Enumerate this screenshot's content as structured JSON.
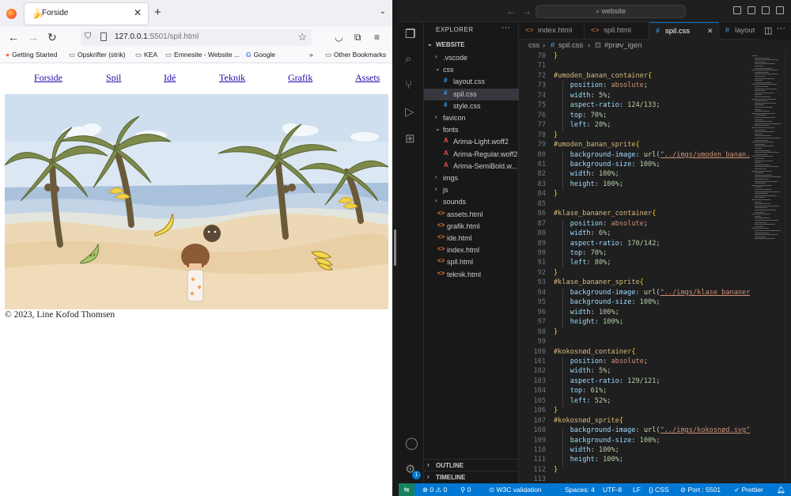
{
  "browser": {
    "tab_title": "Forside",
    "url_host": "127.0.0.1",
    "url_rest": ":5501/spil.html",
    "bookmarks": [
      "Getting Started",
      "Opskrifter (strik)",
      "KEA",
      "Emnesite - Website ...",
      "Google",
      "Other Bookmarks"
    ],
    "site_nav": [
      "Forside",
      "Spil",
      "Idé",
      "Teknik",
      "Grafik",
      "Assets"
    ],
    "footer": "© 2023, Line Kofod Thomsen"
  },
  "vscode": {
    "search_text": "website",
    "explorer_title": "EXPLORER",
    "workspace": "WEBSITE",
    "tree": [
      {
        "name": ".vscode",
        "type": "folder",
        "open": false,
        "depth": 0
      },
      {
        "name": "css",
        "type": "folder",
        "open": true,
        "depth": 0
      },
      {
        "name": "layout.css",
        "type": "css",
        "depth": 1
      },
      {
        "name": "spil.css",
        "type": "css",
        "depth": 1,
        "selected": true
      },
      {
        "name": "style.css",
        "type": "css",
        "depth": 1
      },
      {
        "name": "favicon",
        "type": "folder",
        "open": false,
        "depth": 0
      },
      {
        "name": "fonts",
        "type": "folder",
        "open": true,
        "depth": 0
      },
      {
        "name": "Arima-Light.woff2",
        "type": "font",
        "depth": 1
      },
      {
        "name": "Arima-Regular.woff2",
        "type": "font",
        "depth": 1
      },
      {
        "name": "Arima-SemiBold.w...",
        "type": "font",
        "depth": 1
      },
      {
        "name": "imgs",
        "type": "folder",
        "open": false,
        "depth": 0
      },
      {
        "name": "js",
        "type": "folder",
        "open": false,
        "depth": 0
      },
      {
        "name": "sounds",
        "type": "folder",
        "open": false,
        "depth": 0
      },
      {
        "name": "assets.html",
        "type": "html",
        "depth": 0
      },
      {
        "name": "grafik.html",
        "type": "html",
        "depth": 0
      },
      {
        "name": "ide.html",
        "type": "html",
        "depth": 0
      },
      {
        "name": "index.html",
        "type": "html",
        "depth": 0
      },
      {
        "name": "spil.html",
        "type": "html",
        "depth": 0
      },
      {
        "name": "teknik.html",
        "type": "html",
        "depth": 0
      }
    ],
    "outline_label": "OUTLINE",
    "timeline_label": "TIMELINE",
    "tabs": [
      {
        "label": "index.html",
        "icon": "html",
        "active": false
      },
      {
        "label": "spil.html",
        "icon": "html",
        "active": false
      },
      {
        "label": "spil.css",
        "icon": "css",
        "active": true
      },
      {
        "label": "layout",
        "icon": "css",
        "active": false
      }
    ],
    "breadcrumb": [
      "css",
      "spil.css",
      "#prøv_igen"
    ],
    "code_lines": [
      {
        "n": "70",
        "t": "}"
      },
      {
        "n": "71",
        "t": ""
      },
      {
        "n": "72",
        "t": "#umoden_banan_container{"
      },
      {
        "n": "73",
        "t": "    position: absolute;"
      },
      {
        "n": "74",
        "t": "    width: 5%;"
      },
      {
        "n": "75",
        "t": "    aspect-ratio: 124/133;"
      },
      {
        "n": "76",
        "t": "    top: 70%;"
      },
      {
        "n": "77",
        "t": "    left: 20%;"
      },
      {
        "n": "78",
        "t": "}"
      },
      {
        "n": "79",
        "t": "#umoden_banan_sprite{"
      },
      {
        "n": "80",
        "t": "    background-image: url(\"../imgs/umoden_banan.svg\");"
      },
      {
        "n": "81",
        "t": "    background-size: 100%;"
      },
      {
        "n": "82",
        "t": "    width: 100%;"
      },
      {
        "n": "83",
        "t": "    height: 100%;"
      },
      {
        "n": "84",
        "t": "}"
      },
      {
        "n": "85",
        "t": ""
      },
      {
        "n": "86",
        "t": "#klase_bananer_container{"
      },
      {
        "n": "87",
        "t": "    position: absolute;"
      },
      {
        "n": "88",
        "t": "    width: 6%;"
      },
      {
        "n": "89",
        "t": "    aspect-ratio: 170/142;"
      },
      {
        "n": "90",
        "t": "    top: 70%;"
      },
      {
        "n": "91",
        "t": "    left: 80%;"
      },
      {
        "n": "92",
        "t": "}"
      },
      {
        "n": "93",
        "t": "#klase_bananer_sprite{"
      },
      {
        "n": "94",
        "t": "    background-image: url(\"../imgs/klase_bananer.svg\");"
      },
      {
        "n": "95",
        "t": "    background-size: 100%;"
      },
      {
        "n": "96",
        "t": "    width: 100%;"
      },
      {
        "n": "97",
        "t": "    height: 100%;"
      },
      {
        "n": "98",
        "t": "}"
      },
      {
        "n": "99",
        "t": ""
      },
      {
        "n": "100",
        "t": "#kokosnød_container{"
      },
      {
        "n": "101",
        "t": "    position: absolute;"
      },
      {
        "n": "102",
        "t": "    width: 5%;"
      },
      {
        "n": "103",
        "t": "    aspect-ratio: 129/121;"
      },
      {
        "n": "104",
        "t": "    top: 61%;"
      },
      {
        "n": "105",
        "t": "    left: 52%;"
      },
      {
        "n": "106",
        "t": "}"
      },
      {
        "n": "107",
        "t": "#kokosnød_sprite{"
      },
      {
        "n": "108",
        "t": "    background-image: url(\"../imgs/kokosnød.svg\");"
      },
      {
        "n": "109",
        "t": "    background-size: 100%;"
      },
      {
        "n": "110",
        "t": "    width: 100%;"
      },
      {
        "n": "111",
        "t": "    height: 100%;"
      },
      {
        "n": "112",
        "t": "}"
      },
      {
        "n": "113",
        "t": ""
      }
    ],
    "status": {
      "problems": "⊗ 0 ⚠ 0",
      "ports": "⚲ 0",
      "w3c": "W3C validation",
      "spaces": "Spaces: 4",
      "encoding": "UTF-8",
      "eol": "LF",
      "language": "{} CSS",
      "port": "Port : 5501",
      "prettier": "Prettier"
    },
    "accounts_badge": "1"
  }
}
